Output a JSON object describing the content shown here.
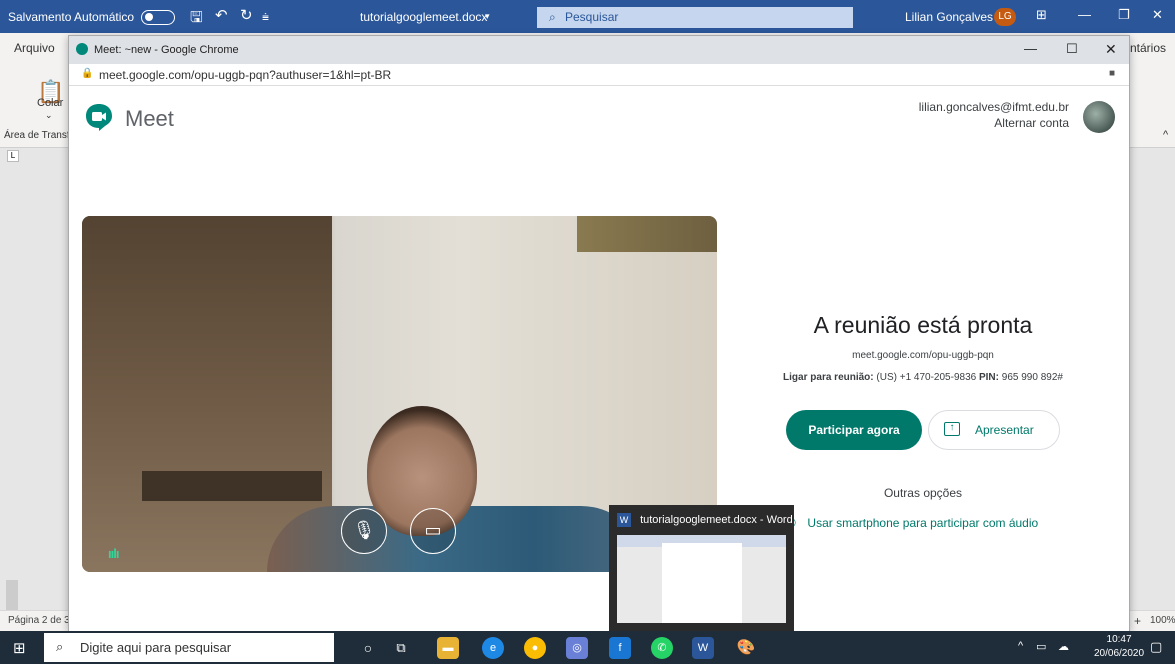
{
  "word": {
    "autosave_label": "Salvamento Automático",
    "doc_name": "tutorialgooglemeet.docx",
    "search_placeholder": "Pesquisar",
    "user_name": "Lilian Gonçalves",
    "user_initials": "LG",
    "menu_arquivo": "Arquivo",
    "paste_label": "Colar",
    "clipboard_label": "Área de Transf",
    "comments_label": "ntários",
    "page_status": "Página 2 de 3",
    "zoom": "100%"
  },
  "chrome": {
    "tab_title": "Meet: ~new - Google Chrome",
    "url": "meet.google.com/opu-uggb-pqn?authuser=1&hl=pt-BR"
  },
  "meet": {
    "app_name": "Meet",
    "account_email": "lilian.goncalves@ifmt.edu.br",
    "switch_account": "Alternar conta",
    "ready_title": "A reunião está pronta",
    "meeting_link": "meet.google.com/opu-uggb-pqn",
    "phone_label": "Ligar para reunião:",
    "phone_number": "(US) +1 470-205-9836",
    "pin_label": "PIN:",
    "pin_value": "965 990 892#",
    "join_button": "Participar agora",
    "present_button": "Apresentar",
    "other_options": "Outras opções",
    "smartphone_option": "Usar smartphone para participar com áudio"
  },
  "thumbnail": {
    "title": "tutorialgooglemeet.docx - Word"
  },
  "taskbar": {
    "search_placeholder": "Digite aqui para pesquisar",
    "time": "10:47",
    "date": "20/06/2020"
  },
  "colors": {
    "word_blue": "#2b579a",
    "meet_green": "#00796b"
  }
}
